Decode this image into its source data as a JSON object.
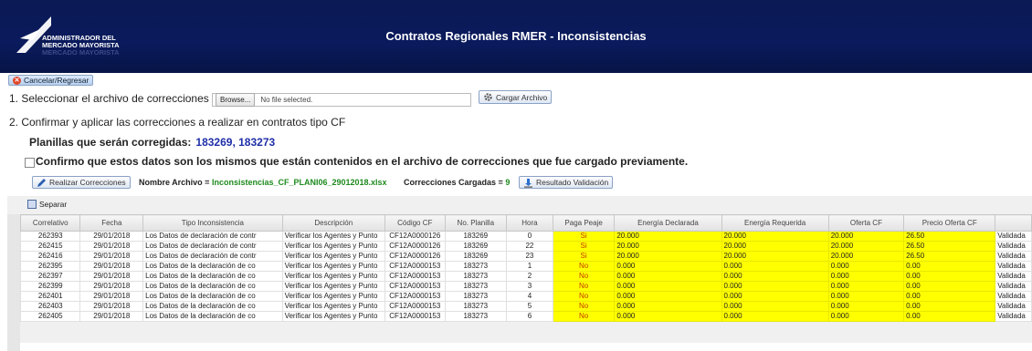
{
  "header": {
    "logo_line1": "ADMINISTRADOR DEL",
    "logo_line2": "MERCADO MAYORISTA",
    "logo_line3": "MERCADO MAYORISTA",
    "title": "Contratos Regionales RMER - Inconsistencias"
  },
  "actions": {
    "cancel_label": "Cancelar/Regresar",
    "browse_label": "Browse...",
    "file_status": "No file selected.",
    "load_label": "Cargar Archivo",
    "apply_label": "Realizar Correcciones",
    "validation_label": "Resultado Validación",
    "split_label": "Separar"
  },
  "steps": {
    "step1": "1. Seleccionar el archivo de correcciones",
    "step2": "2. Confirmar y aplicar las correcciones a realizar en contratos tipo CF",
    "planillas_label": "Planillas que serán corregidas:",
    "planillas_value": "183269, 183273",
    "confirm_text": "Confirmo que estos datos son los mismos que están contenidos en el archivo de correcciones que fue cargado previamente."
  },
  "meta": {
    "file_label": "Nombre Archivo =",
    "file_name": "Inconsistencias_CF_PLANI06_29012018.xlsx",
    "count_label": "Correcciones Cargadas =",
    "count_value": "9"
  },
  "colors": {
    "header_bg": "#0a1a5c",
    "highlight": "#ffff00",
    "accent_green": "#1e8a1e",
    "accent_blue": "#1e2ea8"
  },
  "table": {
    "columns": [
      "Correlativo",
      "Fecha",
      "Tipo Inconsistencia",
      "Descripción",
      "Código CF",
      "No. Planilla",
      "Hora",
      "Paga Peaje",
      "Energía Declarada",
      "Energía Requerida",
      "Oferta CF",
      "Precio Oferta CF",
      ""
    ],
    "rows": [
      [
        "262393",
        "29/01/2018",
        "Los Datos de declaración de contr",
        "Verificar los Agentes y Punto",
        "CF12A0000126",
        "183269",
        "0",
        "Si",
        "20.000",
        "20.000",
        "20.000",
        "26.50",
        "Validada"
      ],
      [
        "262415",
        "29/01/2018",
        "Los Datos de declaración de contr",
        "Verificar los Agentes y Punto",
        "CF12A0000126",
        "183269",
        "22",
        "Si",
        "20.000",
        "20.000",
        "20.000",
        "26.50",
        "Validada"
      ],
      [
        "262416",
        "29/01/2018",
        "Los Datos de declaración de contr",
        "Verificar los Agentes y Punto",
        "CF12A0000126",
        "183269",
        "23",
        "Si",
        "20.000",
        "20.000",
        "20.000",
        "26.50",
        "Validada"
      ],
      [
        "262395",
        "29/01/2018",
        "Los Datos de la declaración de co",
        "Verificar los Agentes y Punto",
        "CF12A0000153",
        "183273",
        "1",
        "No",
        "0.000",
        "0.000",
        "0.000",
        "0.00",
        "Validada"
      ],
      [
        "262397",
        "29/01/2018",
        "Los Datos de la declaración de co",
        "Verificar los Agentes y Punto",
        "CF12A0000153",
        "183273",
        "2",
        "No",
        "0.000",
        "0.000",
        "0.000",
        "0.00",
        "Validada"
      ],
      [
        "262399",
        "29/01/2018",
        "Los Datos de la declaración de co",
        "Verificar los Agentes y Punto",
        "CF12A0000153",
        "183273",
        "3",
        "No",
        "0.000",
        "0.000",
        "0.000",
        "0.00",
        "Validada"
      ],
      [
        "262401",
        "29/01/2018",
        "Los Datos de la declaración de co",
        "Verificar los Agentes y Punto",
        "CF12A0000153",
        "183273",
        "4",
        "No",
        "0.000",
        "0.000",
        "0.000",
        "0.00",
        "Validada"
      ],
      [
        "262403",
        "29/01/2018",
        "Los Datos de la declaración de co",
        "Verificar los Agentes y Punto",
        "CF12A0000153",
        "183273",
        "5",
        "No",
        "0.000",
        "0.000",
        "0.000",
        "0.00",
        "Validada"
      ],
      [
        "262405",
        "29/01/2018",
        "Los Datos de la declaración de co",
        "Verificar los Agentes y Punto",
        "CF12A0000153",
        "183273",
        "6",
        "No",
        "0.000",
        "0.000",
        "0.000",
        "0.00",
        "Validada"
      ]
    ]
  }
}
